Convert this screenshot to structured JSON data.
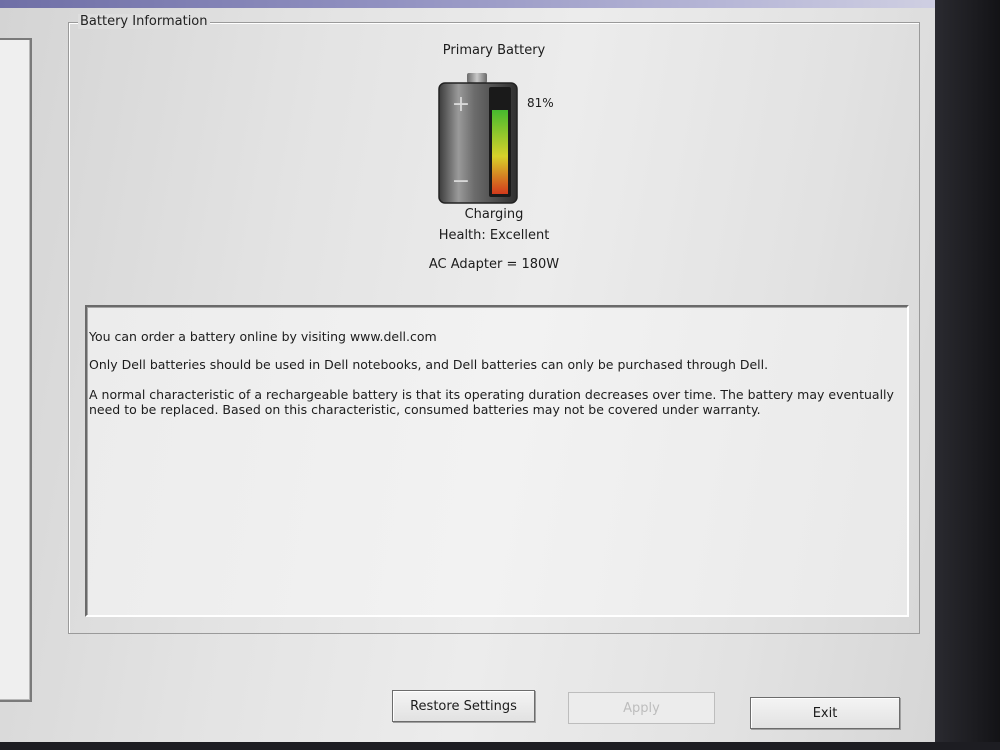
{
  "group": {
    "title": "Battery Information"
  },
  "battery": {
    "title": "Primary Battery",
    "charge_percent_label": "81%",
    "charge_level": 0.81,
    "status": "Charging",
    "health": "Health: Excellent",
    "adapter": "AC Adapter = 180W",
    "plus_symbol": "+",
    "minus_symbol": "−"
  },
  "info": {
    "line1": "You can order a battery online by visiting www.dell.com",
    "line2": "Only Dell batteries should be used in Dell notebooks, and Dell batteries can only be purchased through Dell.",
    "line3": "A normal characteristic of a rechargeable battery is that its operating duration decreases over time.  The battery may eventually need to be replaced.  Based on this characteristic, consumed batteries may not be covered under warranty."
  },
  "buttons": {
    "restore": "Restore Settings",
    "apply": "Apply",
    "exit": "Exit"
  },
  "colors": {
    "gauge_top": "#46b82e",
    "gauge_mid": "#d7d12a",
    "gauge_bottom": "#d23a1c",
    "battery_body": "#5a5a5a"
  }
}
